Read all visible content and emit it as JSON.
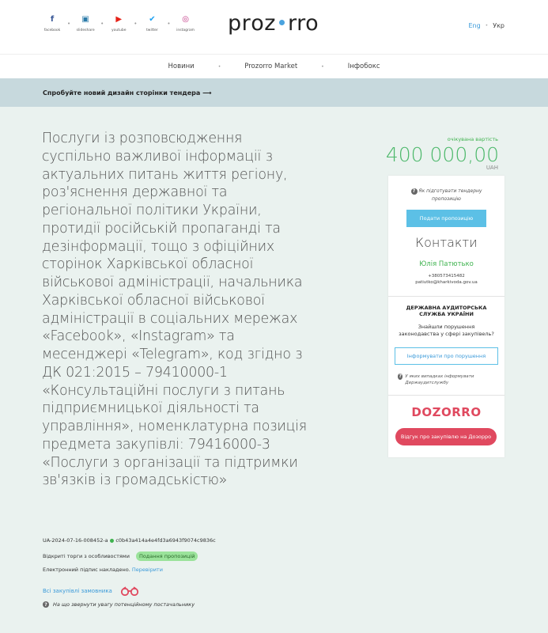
{
  "header": {
    "social": [
      {
        "icon": "facebook-icon",
        "glyph": "f",
        "color": "#3b5998",
        "label": "facebook"
      },
      {
        "icon": "slideshare-icon",
        "glyph": "▣",
        "color": "#2a7aa8",
        "label": "slideshare"
      },
      {
        "icon": "youtube-icon",
        "glyph": "▶",
        "color": "#e62117",
        "label": "youtube"
      },
      {
        "icon": "twitter-icon",
        "glyph": "✔",
        "color": "#1da1f2",
        "label": "twitter"
      },
      {
        "icon": "instagram-icon",
        "glyph": "◎",
        "color": "#c13584",
        "label": "instagram"
      }
    ],
    "logo_left": "prоz",
    "logo_right": "rro",
    "lang_eng": "Eng",
    "lang_ukr": "Укр"
  },
  "nav": {
    "items": [
      "Новини",
      "Prozorro Market",
      "Інфобокс"
    ]
  },
  "banner": {
    "text": "Спробуйте новий дизайн сторінки тендера ⟶"
  },
  "tender": {
    "title": "Послуги із розповсюдження суспільно важливої інформації з актуальних питань життя регіону, роз'яснення державної та регіональної політики України, протидії російській пропаганді та дезінформації, тощо з офіційних сторінок Харківської обласної військової адміністрації, начальника Харківської обласної військової адміністрації в соціальних мережах «Facebook», «Instagram» та месенджері «Telegram», код згідно з ДК 021:2015 – 79410000-1 «Консультаційні послуги з питань підприємницької діяльності та управління», номенклатурна позиція предмета закупівлі: 79416000-3 «Послуги з організації та підтримки зв'язків із громадськістю»",
    "id": "UA-2024-07-16-008452-a",
    "hash": "c0b43a414a4e4fd3a6943f9074c9836c",
    "procedure": "Відкриті торги з особливостями",
    "status": "Подання пропозицій",
    "signature_text": "Електронний підпис накладено.",
    "signature_link": "Перевірити",
    "all_purchases": "Всі закупівлі замовника",
    "attention": "На що звернути увагу потенційному постачальнику"
  },
  "sidebar": {
    "expected_label": "очікувана вартість",
    "price": "400 000,00",
    "currency": "UAH",
    "how_to": "Як підготувати тендерну пропозицію",
    "submit": "Подати пропозицію",
    "contacts_heading": "Контакти",
    "contact_name": "Юлія Патютько",
    "contact_phone": "+380573415482",
    "contact_email": "patiutko@kharkivoda.gov.ua",
    "dasu_heading": "ДЕРЖАВНА АУДИТОРСЬКА СЛУЖБА УКРАЇНИ",
    "dasu_question": "Знайшли порушення законодавства у сфері закупівель?",
    "inform_button": "Інформувати про порушення",
    "dasu_note": "У яких випадках інформувати Держаудитслужбу",
    "dozorro_logo": "DOZORRO",
    "dozorro_button": "Відгук про закупівлю на Дозорро"
  }
}
